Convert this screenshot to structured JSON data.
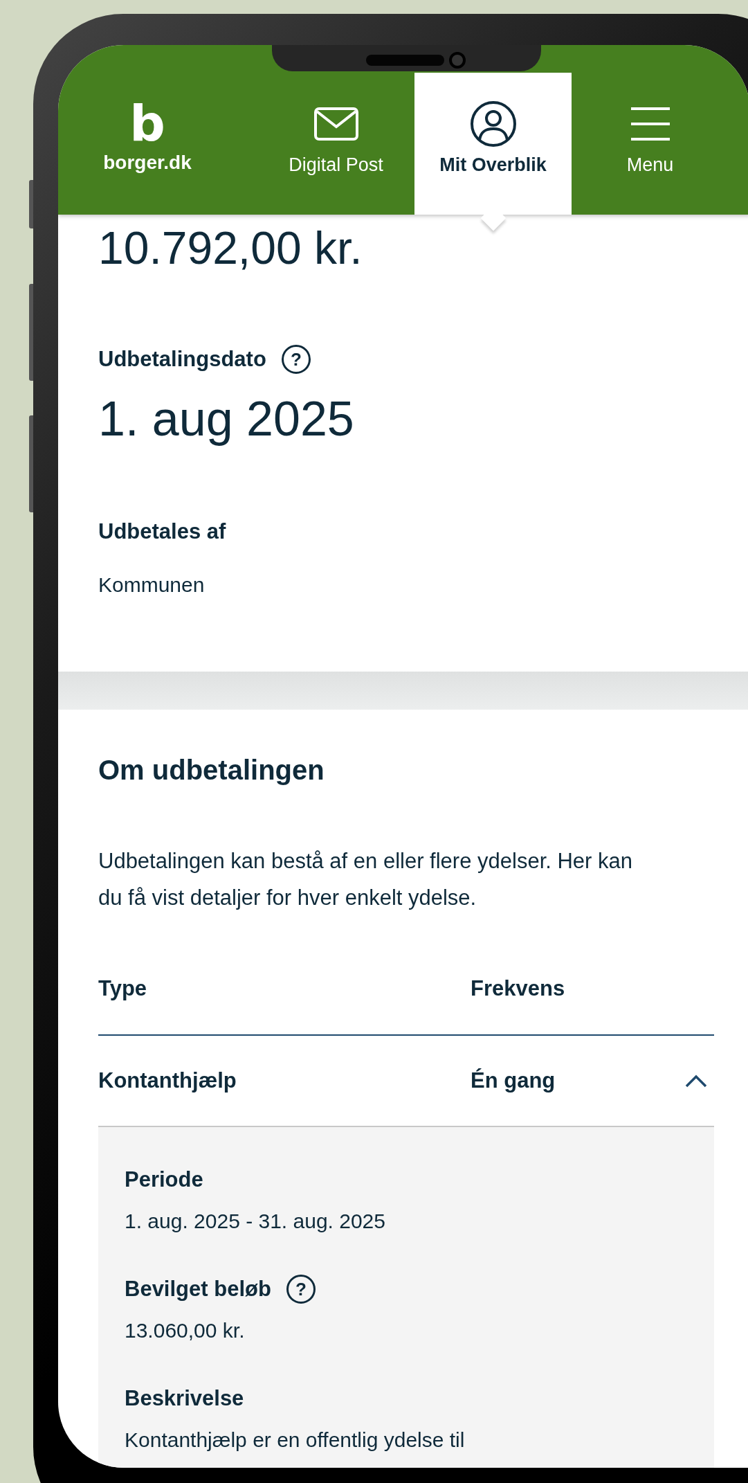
{
  "header": {
    "logo_letter": "b",
    "logo_text": "borger.dk",
    "nav": [
      {
        "label": "Digital Post",
        "kind": "mail",
        "selected": false
      },
      {
        "label": "Mit Overblik",
        "kind": "account",
        "selected": true
      },
      {
        "label": "Menu",
        "kind": "menu",
        "selected": false
      }
    ]
  },
  "summary": {
    "amount": "10.792,00 kr.",
    "fields": [
      {
        "label": "Udbetalingsdato",
        "help": "?",
        "value": "1. aug 2025",
        "kind": "large"
      },
      {
        "label": "Udbetales af",
        "value": "Kommunen",
        "kind": "normal"
      }
    ]
  },
  "details": {
    "title": "Om udbetalingen",
    "intro": "Udbetalingen kan bestå af en eller flere ydelser. Her kan du få vist detaljer for hver enkelt ydelse.",
    "columns": [
      "Type",
      "Frekvens"
    ],
    "rows": [
      {
        "type": "Kontanthjælp",
        "frequency": "Én gang",
        "expanded": true,
        "fields": [
          {
            "label": "Periode",
            "value": "1. aug. 2025 - 31. aug. 2025"
          },
          {
            "label": "Bevilget beløb",
            "help": "?",
            "value": "13.060,00 kr."
          },
          {
            "label": "Beskrivelse",
            "value": "Kontanthjælp er en offentlig ydelse til"
          }
        ]
      }
    ]
  }
}
